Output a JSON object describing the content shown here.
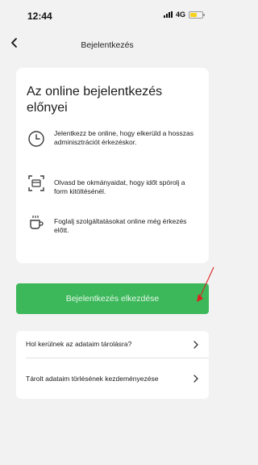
{
  "status_bar": {
    "time": "12:44",
    "network": "4G",
    "battery_color": "#f7d21c"
  },
  "nav": {
    "back_icon": "chevron-left-icon",
    "title": "Bejelentkezés"
  },
  "benefits_card": {
    "title": "Az online bejelentkezés előnyei",
    "items": [
      {
        "icon": "clock-icon",
        "text": "Jelentkezz be online, hogy elkerüld a hosszas adminisztrációt érkezéskor."
      },
      {
        "icon": "id-scan-icon",
        "text": "Olvasd be okmányaidat, hogy időt spórolj a form kitöltésénél."
      },
      {
        "icon": "coffee-cup-icon",
        "text": "Foglalj szolgáltatásokat online még érkezés előtt."
      }
    ]
  },
  "primary_action": {
    "label": "Bejelentkezés elkezdése",
    "color": "#3cb85a"
  },
  "info_links": [
    {
      "label": "Hol kerülnek az adataim tárolásra?",
      "icon": "chevron-right-icon"
    },
    {
      "label": "Tárolt adataim törlésének kezdeményezése",
      "icon": "chevron-right-icon"
    }
  ],
  "annotation_color": "#e02020"
}
